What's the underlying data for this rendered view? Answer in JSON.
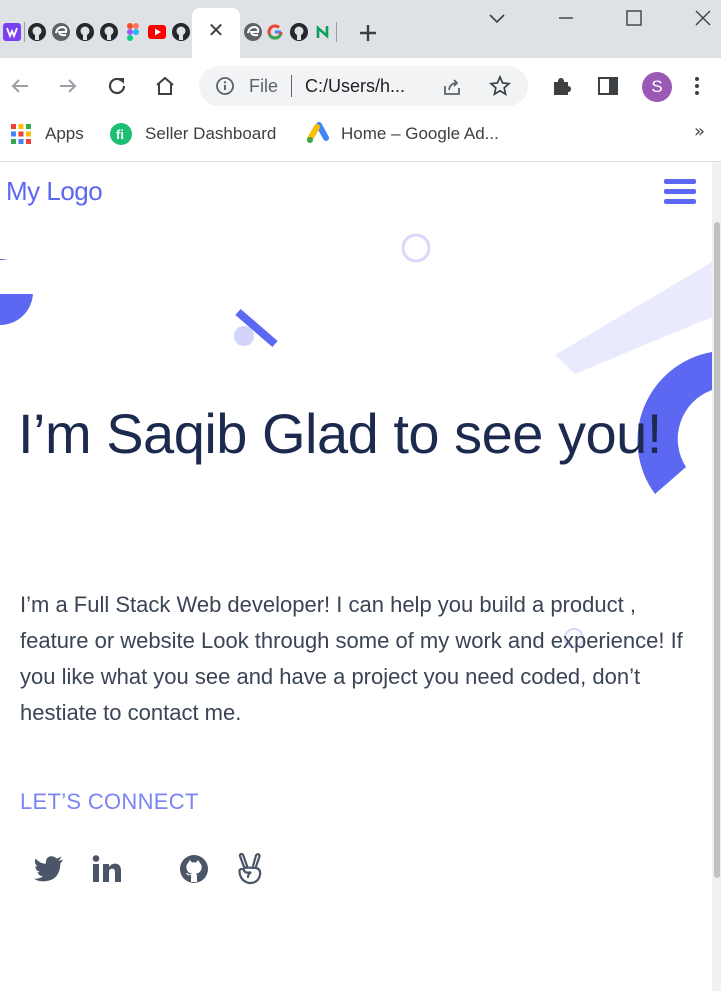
{
  "browser": {
    "tabs": [
      {
        "icon": "monitor-icon",
        "color": "#7b3ff2"
      },
      {
        "icon": "github-icon"
      },
      {
        "icon": "edge-icon"
      },
      {
        "icon": "github-icon"
      },
      {
        "icon": "github-icon"
      },
      {
        "icon": "figma-icon"
      },
      {
        "icon": "youtube-icon"
      },
      {
        "icon": "github-icon"
      },
      {
        "icon": "close-icon",
        "active": true
      },
      {
        "icon": "edge-icon"
      },
      {
        "icon": "google-icon"
      },
      {
        "icon": "github-icon"
      },
      {
        "icon": "upwork-icon"
      }
    ],
    "active_tab_close": "✕",
    "new_tab": "+",
    "omnibox": {
      "scheme_label": "File",
      "url": "C:/Users/h..."
    },
    "profile_initial": "S",
    "profile_color": "#9b59b6",
    "bookmarks": [
      {
        "label": "Apps",
        "icon": "apps-grid-icon"
      },
      {
        "label": "Seller Dashboard",
        "icon": "fiverr-icon"
      },
      {
        "label": "Home – Google Ad...",
        "icon": "google-ads-icon"
      }
    ],
    "bookmarks_overflow": "»"
  },
  "page": {
    "logo": "My Logo",
    "hero": {
      "title": "I’m Saqib Glad to see you!",
      "description": "I’m a Full Stack Web developer! I can help you build a product , feature or website Look through some of my work and experience! If you like what you see and have a project you need coded, don’t hestiate to contact me.",
      "cta": "LET’S CONNECT"
    },
    "social": [
      {
        "icon": "twitter-icon"
      },
      {
        "icon": "linkedin-icon"
      },
      {
        "icon": "github-icon"
      },
      {
        "icon": "angellist-icon"
      }
    ],
    "colors": {
      "accent": "#5c67f2",
      "heading": "#1b2a4e",
      "body": "#3a4454",
      "cta": "#7b84f5",
      "social": "#4a5568"
    }
  }
}
